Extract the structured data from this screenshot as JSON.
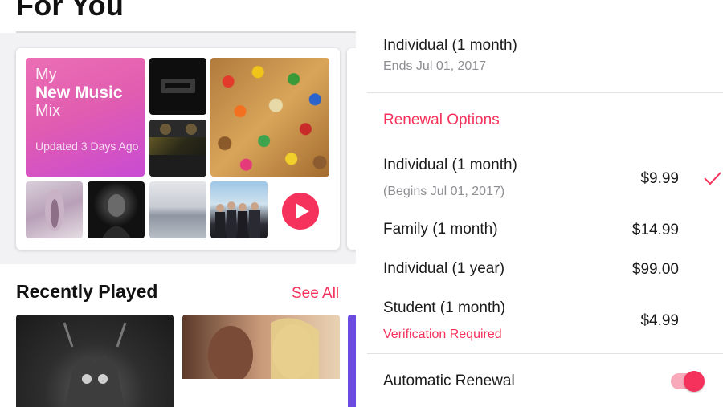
{
  "left": {
    "page_title": "For You",
    "mix": {
      "line1": "My",
      "line2": "New Music",
      "line3": "Mix",
      "updated": "Updated 3 Days Ago"
    },
    "recently_played": {
      "title": "Recently Played",
      "see_all": "See All"
    }
  },
  "right": {
    "current_plan": {
      "name": "Individual (1 month)",
      "ends": "Ends Jul 01, 2017"
    },
    "renewal_options_header": "Renewal Options",
    "options": [
      {
        "name": "Individual (1 month)",
        "sub": "(Begins Jul 01, 2017)",
        "price": "$9.99",
        "selected": true
      },
      {
        "name": "Family (1 month)",
        "price": "$14.99"
      },
      {
        "name": "Individual (1 year)",
        "price": "$99.00"
      },
      {
        "name": "Student (1 month)",
        "warning": "Verification Required",
        "price": "$4.99"
      }
    ],
    "automatic_renewal": {
      "label": "Automatic Renewal",
      "enabled": true
    }
  },
  "colors": {
    "accent": "#f5325b",
    "secondary_text": "#8e8e93"
  }
}
